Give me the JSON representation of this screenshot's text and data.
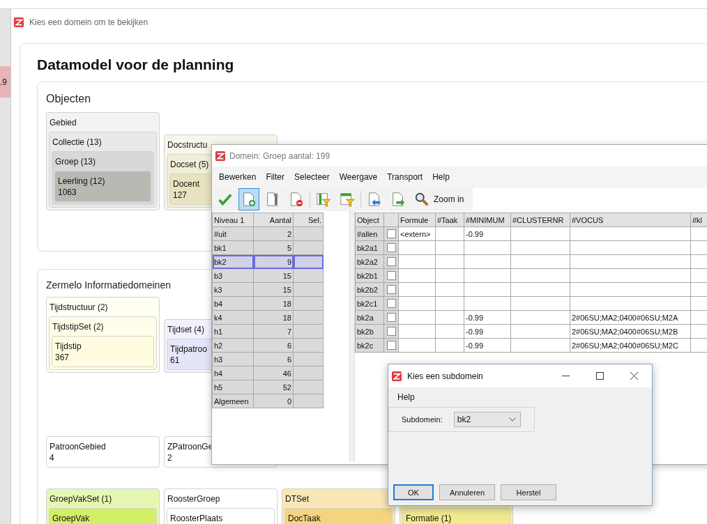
{
  "edge_text": ".9",
  "app_window": {
    "title": "Kies een domein om te bekijken",
    "heading": "Datamodel voor de planning",
    "sections": [
      {
        "title": "Objecten",
        "rows": [
          [
            {
              "label": "Gebied",
              "color": "#f3f3f3",
              "children": [
                {
                  "label": "Collectie (13)",
                  "color": "#e9e9e9",
                  "children": [
                    {
                      "label": "Groep (13)",
                      "color": "#d8d8d8",
                      "children": [
                        {
                          "label": "Leerling (12)",
                          "value": "1063",
                          "color": "#b9b9b3"
                        }
                      ]
                    }
                  ]
                }
              ]
            },
            {
              "label": "Docstructu",
              "color": "#f8f6ea",
              "children": [
                {
                  "label": "Docset (5)",
                  "color": "#f1eed8",
                  "children": [
                    {
                      "label": "Docent",
                      "value": "127",
                      "color": "#e8e2c0"
                    }
                  ]
                }
              ]
            }
          ]
        ]
      },
      {
        "title": "Zermelo Informatiedomeinen",
        "rows": [
          [
            {
              "label": "Tijdstructuur (2)",
              "color": "#fffff4",
              "children": [
                {
                  "label": "TijdstipSet (2)",
                  "color": "#fffdea",
                  "children": [
                    {
                      "label": "Tijdstip",
                      "value": "367",
                      "color": "#fffcdf"
                    }
                  ]
                }
              ]
            },
            {
              "label": "Tijdset (4)",
              "color": "#f2f2fd",
              "children": [
                {
                  "label": "Tijdpatroo",
                  "value": "61",
                  "color": "#e5e5fa"
                }
              ]
            }
          ],
          [
            {
              "label": "PatroonGebied",
              "value": "4",
              "color": "#ffffff"
            },
            {
              "label": "ZPatroonGe",
              "value": "2",
              "color": "#ffffff"
            }
          ],
          [
            {
              "label": "GroepVakSet (1)",
              "color": "#e6f7b4",
              "children": [
                {
                  "label": "GroepVak",
                  "color": "#d3ef66"
                }
              ]
            },
            {
              "label": "RoosterGroep",
              "color": "#ffffff",
              "children": [
                {
                  "label": "RoosterPlaats",
                  "color": "#ffffff"
                }
              ]
            },
            {
              "label": "DTSet",
              "color": "#f9e7b8",
              "children": [
                {
                  "label": "DocTaak",
                  "color": "#f4d47e"
                }
              ]
            },
            {
              "color": "#f6efa8",
              "children": [
                {
                  "label": "Formatie (1)",
                  "color": "#f2e98e"
                }
              ]
            }
          ]
        ]
      }
    ]
  },
  "domain_window": {
    "title": "Domein: Groep aantal: 199",
    "menu": [
      "Bewerken",
      "Filter",
      "Selecteer",
      "Weergave",
      "Transport",
      "Help"
    ],
    "toolbar": [
      {
        "kind": "confirm",
        "selected": false
      },
      {
        "kind": "new",
        "selected": true
      },
      {
        "kind": "edit",
        "selected": false
      },
      {
        "kind": "delete",
        "selected": false
      },
      {
        "kind": "separator"
      },
      {
        "kind": "filter-columns",
        "selected": false
      },
      {
        "kind": "filter-rows",
        "selected": false
      },
      {
        "kind": "separator"
      },
      {
        "kind": "previous",
        "selected": false
      },
      {
        "kind": "next",
        "selected": false
      },
      {
        "kind": "zoom",
        "selected": false,
        "label": "Zoom in"
      }
    ],
    "levels_table": {
      "columns": [
        "Niveau 1",
        "Aantal",
        "Sel."
      ],
      "rows": [
        {
          "niveau": "#uit",
          "aantal": "2",
          "selected": false
        },
        {
          "niveau": "bk1",
          "aantal": "5",
          "selected": false
        },
        {
          "niveau": "bk2",
          "aantal": "9",
          "selected": true
        },
        {
          "niveau": "b3",
          "aantal": "15",
          "selected": false
        },
        {
          "niveau": "k3",
          "aantal": "15",
          "selected": false
        },
        {
          "niveau": "b4",
          "aantal": "18",
          "selected": false
        },
        {
          "niveau": "k4",
          "aantal": "18",
          "selected": false
        },
        {
          "niveau": "h1",
          "aantal": "7",
          "selected": false
        },
        {
          "niveau": "h2",
          "aantal": "6",
          "selected": false
        },
        {
          "niveau": "h3",
          "aantal": "6",
          "selected": false
        },
        {
          "niveau": "h4",
          "aantal": "46",
          "selected": false
        },
        {
          "niveau": "h5",
          "aantal": "52",
          "selected": false
        },
        {
          "niveau": "Algemeen",
          "aantal": "0",
          "selected": false
        }
      ]
    },
    "objects_table": {
      "columns": [
        {
          "kind": "text",
          "label": "Object"
        },
        {
          "kind": "check"
        },
        {
          "kind": "text",
          "label": "Formule"
        },
        {
          "kind": "text",
          "label": "#Taak"
        },
        {
          "kind": "text",
          "label": "#MINIMUM"
        },
        {
          "kind": "text",
          "label": "#CLUSTERNR"
        },
        {
          "kind": "text",
          "label": "#VOCUS"
        },
        {
          "kind": "text",
          "label": "#kl"
        }
      ],
      "rows": [
        {
          "object": "#allen",
          "checked": false,
          "formule": "<extern>",
          "minimum": "-0.99"
        },
        {
          "object": "bk2a1",
          "checked": false
        },
        {
          "object": "bk2a2",
          "checked": false
        },
        {
          "object": "bk2b1",
          "checked": false
        },
        {
          "object": "bk2b2",
          "checked": false
        },
        {
          "object": "bk2c1",
          "checked": false
        },
        {
          "object": "bk2a",
          "checked": false,
          "minimum": "-0.99",
          "vocus": "2#06SU;MA2;0400#06SU;M2A"
        },
        {
          "object": "bk2b",
          "checked": false,
          "minimum": "-0.99",
          "vocus": "2#06SU;MA2;0400#06SU;M2B"
        },
        {
          "object": "bk2c",
          "checked": false,
          "minimum": "-0.99",
          "vocus": "2#06SU;MA2;0400#06SU;M2C"
        }
      ]
    }
  },
  "dialog": {
    "title": "Kies een subdomein",
    "menu": [
      "Help"
    ],
    "field_label": "Subdomein:",
    "field_value": "bk2",
    "buttons": [
      {
        "label": "OK",
        "focused": true
      },
      {
        "label": "Annuleren",
        "focused": false
      },
      {
        "label": "Herstel",
        "focused": false
      }
    ]
  }
}
